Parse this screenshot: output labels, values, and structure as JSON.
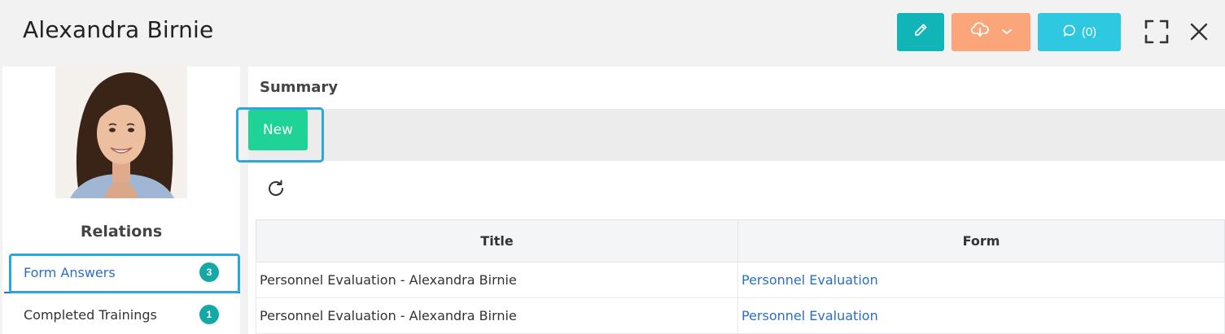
{
  "header": {
    "title": "Alexandra Birnie",
    "comment_label": "(0)",
    "colors": {
      "edit": "#11b5b8",
      "export": "#fba57a",
      "comment": "#2ec8e0"
    }
  },
  "sidebar": {
    "relations_title": "Relations",
    "items": [
      {
        "label": "Form Answers",
        "count": "3",
        "active": true
      },
      {
        "label": "Completed Trainings",
        "count": "1",
        "active": false
      }
    ]
  },
  "main": {
    "summary_title": "Summary",
    "new_label": "New",
    "table": {
      "headers": [
        "Title",
        "Form"
      ],
      "rows": [
        {
          "title": "Personnel Evaluation - Alexandra Birnie",
          "form": "Personnel Evaluation"
        },
        {
          "title": "Personnel Evaluation - Alexandra Birnie",
          "form": "Personnel Evaluation"
        }
      ]
    }
  }
}
